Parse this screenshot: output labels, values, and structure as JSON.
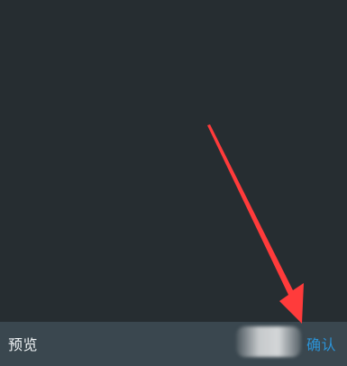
{
  "bottom_bar": {
    "preview_label": "预览",
    "confirm_label": "确认"
  },
  "annotation": {
    "arrow_color": "#ff3b3b"
  },
  "colors": {
    "background": "#262d31",
    "bottom_bar": "#3a474f",
    "confirm_text": "#2b93d7",
    "preview_text": "#eef2f4"
  }
}
